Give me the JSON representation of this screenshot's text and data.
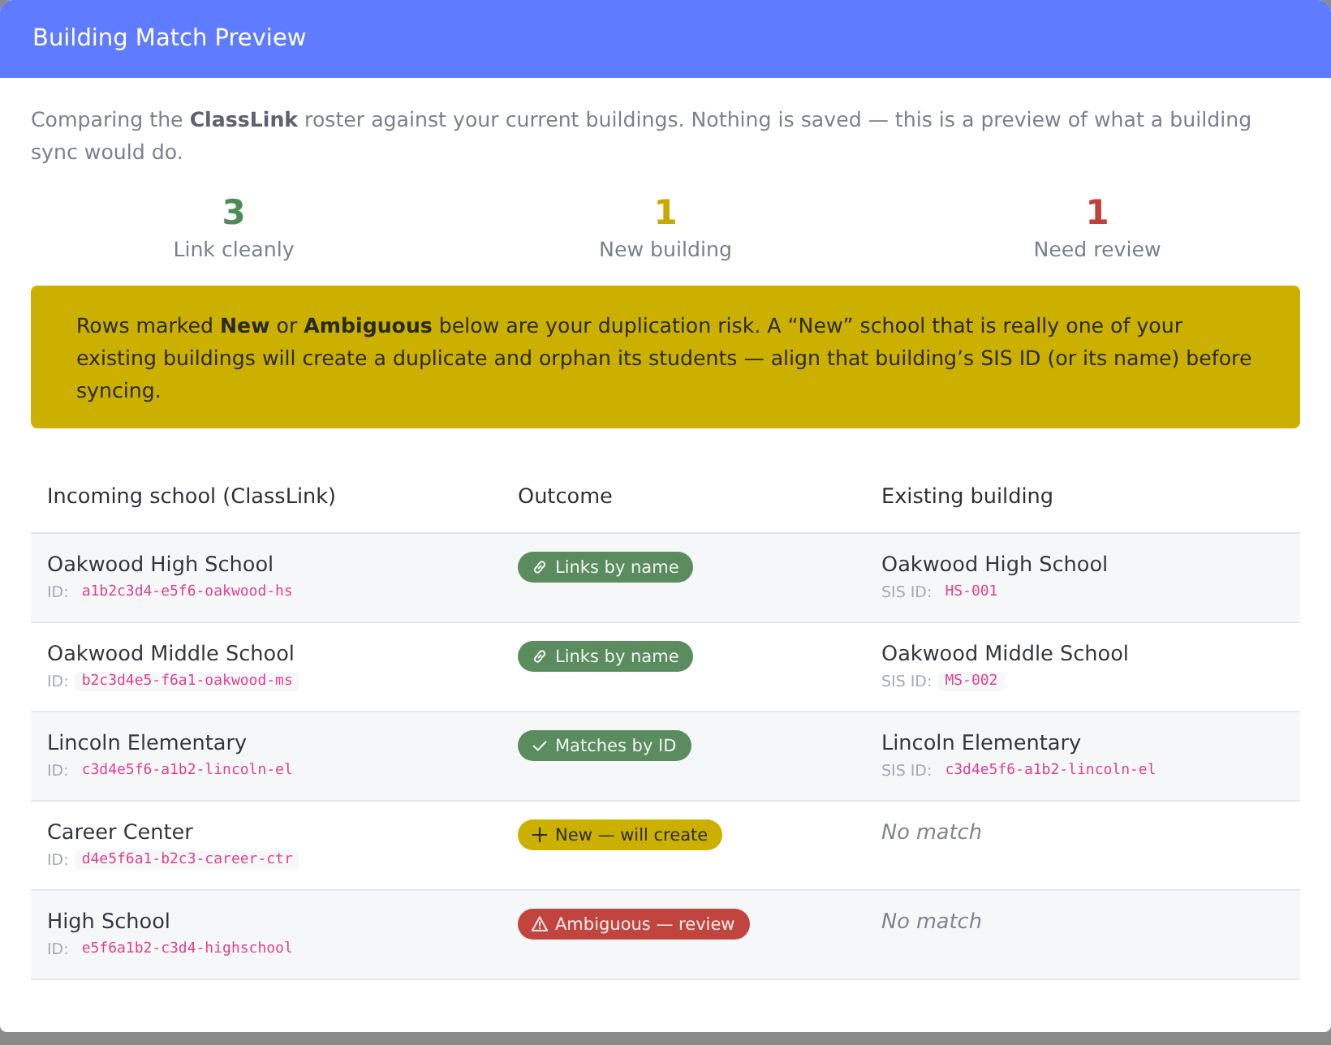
{
  "dialog": {
    "title": "Building Match Preview"
  },
  "intro": "Comparing the **ClassLink** roster against your current buildings. Nothing is saved — this is a preview of what a building sync would do.",
  "summary": [
    {
      "value": "3",
      "label": "Link cleanly",
      "color": "#4e8a55"
    },
    {
      "value": "1",
      "label": "New building",
      "color": "#c9a900"
    },
    {
      "value": "1",
      "label": "Need review",
      "color": "#c0413b"
    }
  ],
  "warning": "Rows marked **New** or **Ambiguous** below are your duplication risk. A “New” school that is really one of your existing buildings will create a duplicate and orphan its students — align that building’s SIS ID (or its name) before syncing.",
  "table": {
    "columns": [
      "Incoming school (ClassLink)",
      "Outcome",
      "Existing building"
    ],
    "rows": [
      {
        "school": "Oakwood High School",
        "id_label": "ID:",
        "id": "a1b2c3d4-e5f6-oakwood-hs",
        "outcome": {
          "kind": "link",
          "label": "Links by name"
        },
        "existing": {
          "kind": "match",
          "name": "Oakwood High School",
          "id_label": "SIS ID:",
          "id": "HS-001"
        }
      },
      {
        "school": "Oakwood Middle School",
        "id_label": "ID:",
        "id": "b2c3d4e5-f6a1-oakwood-ms",
        "outcome": {
          "kind": "link",
          "label": "Links by name"
        },
        "existing": {
          "kind": "match",
          "name": "Oakwood Middle School",
          "id_label": "SIS ID:",
          "id": "MS-002"
        }
      },
      {
        "school": "Lincoln Elementary",
        "id_label": "ID:",
        "id": "c3d4e5f6-a1b2-lincoln-el",
        "outcome": {
          "kind": "id",
          "label": "Matches by ID"
        },
        "existing": {
          "kind": "match",
          "name": "Lincoln Elementary",
          "id_label": "SIS ID:",
          "id": "c3d4e5f6-a1b2-lincoln-el"
        }
      },
      {
        "school": "Career Center",
        "id_label": "ID:",
        "id": "d4e5f6a1-b2c3-career-ctr",
        "outcome": {
          "kind": "new",
          "label": "New — will create"
        },
        "existing": {
          "kind": "none",
          "text": "No match"
        }
      },
      {
        "school": "High School",
        "id_label": "ID:",
        "id": "e5f6a1b2-c3d4-highschool",
        "outcome": {
          "kind": "ambiguous",
          "label": "Ambiguous — review"
        },
        "existing": {
          "kind": "none",
          "text": "No match"
        }
      }
    ]
  }
}
